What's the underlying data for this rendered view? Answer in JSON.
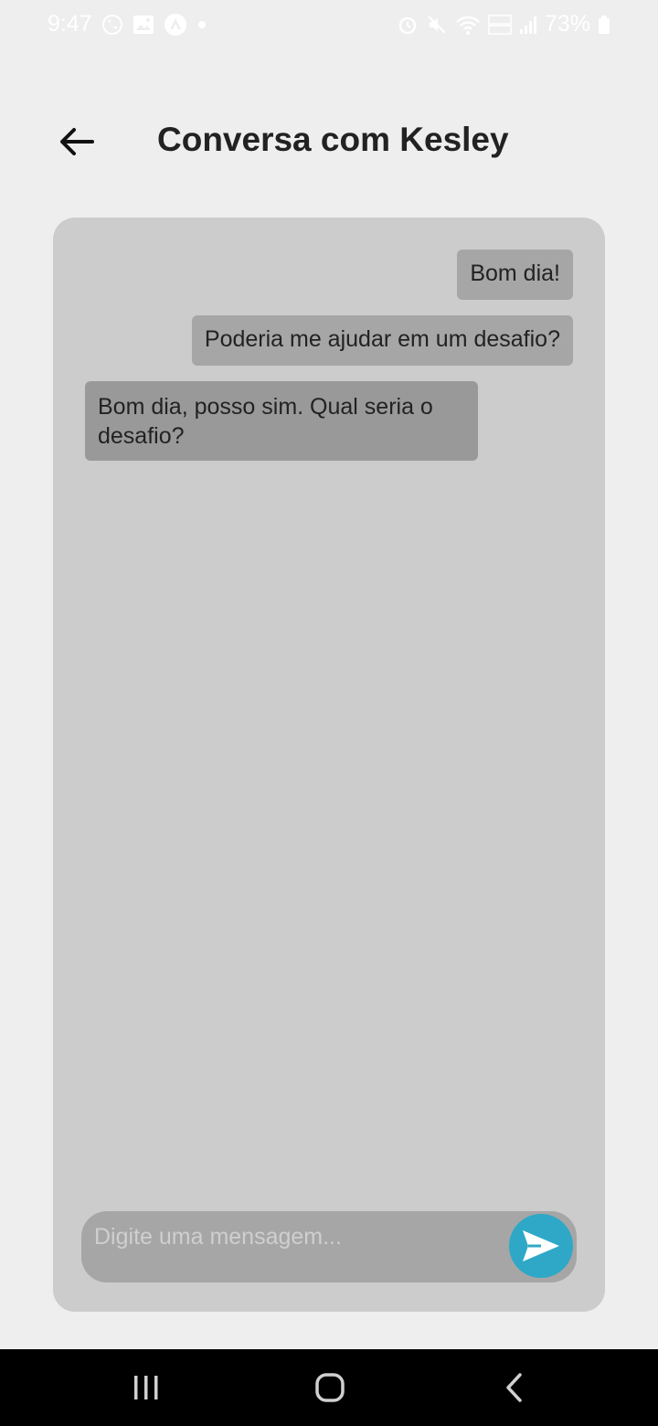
{
  "status_bar": {
    "time": "9:47",
    "battery": "73%",
    "icons_left": [
      "whatsapp-icon",
      "gallery-icon",
      "app-icon",
      "dot-icon"
    ],
    "icons_right": [
      "alarm-icon",
      "mute-icon",
      "wifi-icon",
      "volte-icon",
      "signal-icon",
      "battery-icon"
    ]
  },
  "header": {
    "title": "Conversa com Kesley",
    "back_icon": "arrow-left-icon"
  },
  "chat": {
    "messages": [
      {
        "text": "Bom dia!",
        "direction": "sent"
      },
      {
        "text": "Poderia me ajudar em um desafio?",
        "direction": "sent"
      },
      {
        "text": "Bom dia, posso sim. Qual seria o desafio?",
        "direction": "received"
      }
    ]
  },
  "composer": {
    "placeholder": "Digite uma mensagem...",
    "value": "",
    "send_icon": "send-icon",
    "send_color": "#2ea8c6"
  },
  "nav_bar": {
    "buttons": [
      "recents-icon",
      "home-icon",
      "back-icon"
    ]
  },
  "colors": {
    "background": "#eeeeee",
    "card": "#cccccc",
    "sent_bubble": "#a6a6a6",
    "received_bubble": "#999999"
  }
}
